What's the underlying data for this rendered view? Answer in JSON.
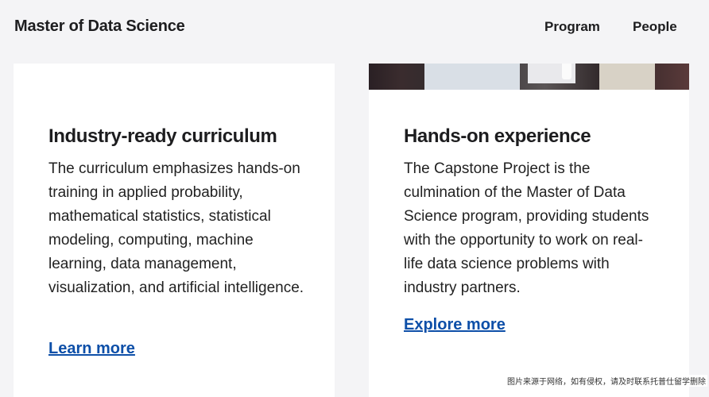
{
  "header": {
    "brand": "Master of Data Science",
    "nav": [
      "Program",
      "People"
    ]
  },
  "cards": [
    {
      "title": "Industry-ready curriculum",
      "body": "The curriculum emphasizes hands-on training in applied probability, mathematical statistics, statistical modeling, computing, machine learning, data management, visualization, and artificial intelligence.",
      "link": "Learn more"
    },
    {
      "title": "Hands-on experience",
      "body": "The Capstone Project is the culmination of the Master of Data Science program, providing students with the opportunity to work on real-life data science problems with industry partners.",
      "link": "Explore more"
    }
  ],
  "watermark": "图片来源于网络，如有侵权，请及时联系托普仕留学删除",
  "colors": {
    "link": "#0d4fa8",
    "background": "#f4f4f6",
    "card": "#ffffff"
  }
}
